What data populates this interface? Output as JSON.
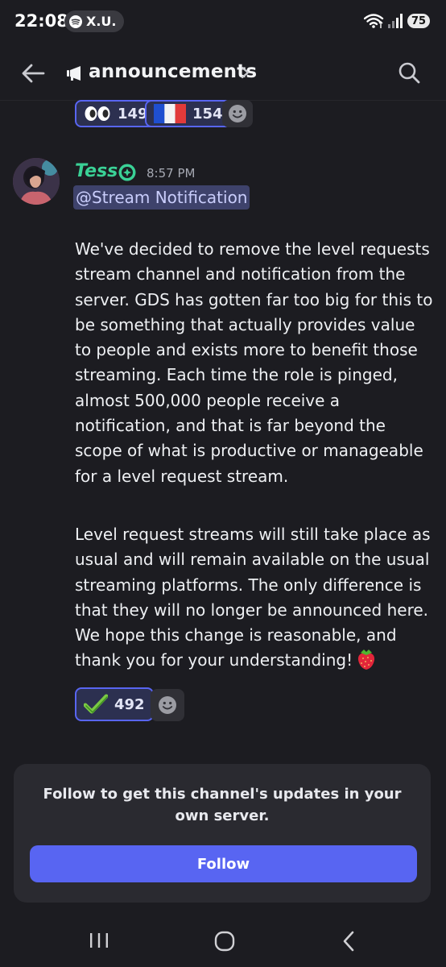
{
  "status_bar": {
    "time": "22:08",
    "media_label": "X.U.",
    "battery": "75"
  },
  "header": {
    "channel_name": "announcements"
  },
  "previous_reactions": [
    {
      "emoji": "eyes",
      "count": "149"
    },
    {
      "emoji": "flag-france",
      "count": "154"
    }
  ],
  "message": {
    "author": "Tess",
    "author_color": "#3ad196",
    "timestamp": "8:57 PM",
    "mention": "@Stream Notification",
    "paragraph1": "We've decided to remove the level requests stream channel and notification from the server. GDS has gotten far too big for this to be something that actually provides value to people and exists more to benefit those streaming. Each time the role is pinged, almost 500,000 people receive a notification, and that is far beyond the scope of what is productive or manageable for a level request stream.",
    "paragraph2": "Level request streams will still take place as usual and will remain available on the usual streaming platforms. The only difference is that they will no longer be announced here. We hope this change is reasonable, and thank you for your understanding!",
    "trailing_emoji": "strawberry",
    "reactions": [
      {
        "emoji": "check-mark",
        "count": "492"
      }
    ]
  },
  "follow_panel": {
    "text": "Follow to get this channel's updates in your own server.",
    "button_label": "Follow",
    "accent_color": "#5865f2"
  }
}
